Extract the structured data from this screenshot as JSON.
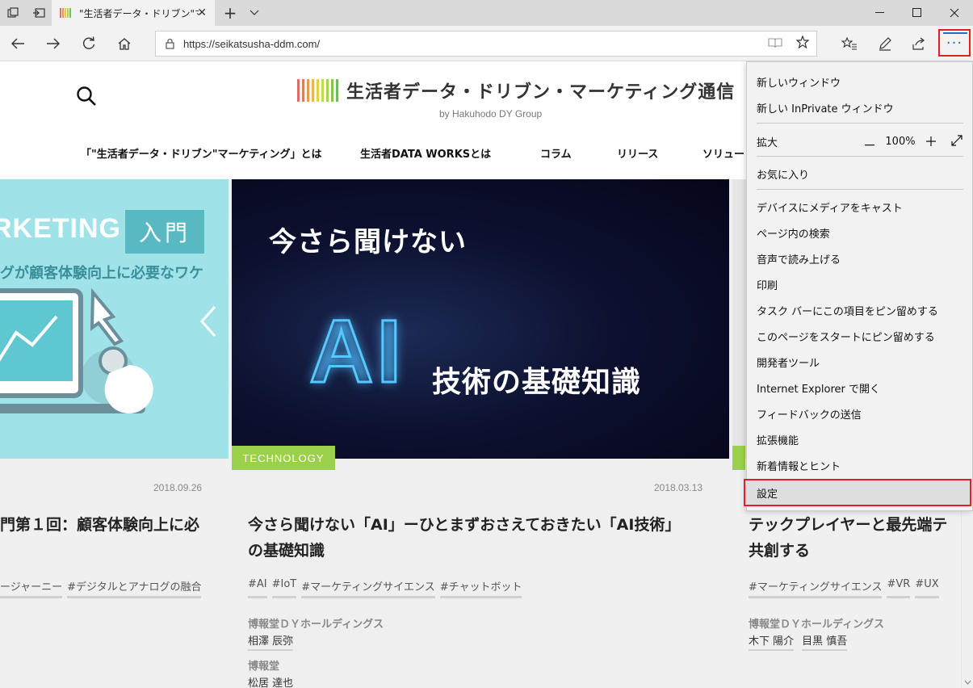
{
  "browser": {
    "tab_title": "\"生活者データ・ドリブン\"マーケ",
    "url": "https://seikatsusha-ddm.com/",
    "tab_close_glyph": "✕",
    "new_tab_glyph": "+",
    "more_glyph": "···"
  },
  "site": {
    "logo_text": "生活者データ・ドリブン・マーケティング通信",
    "logo_sub": "by Hakuhodo DY Group",
    "nav": [
      "「\"生活者データ・ドリブン\"マーケティング」とは",
      "生活者DATA WORKSとは",
      "コラム",
      "リリース",
      "ソリュー"
    ]
  },
  "cards": {
    "left": {
      "hero_word": "RKETING",
      "hero_badge": "入門",
      "hero_sub": "グが顧客体験向上に必要なワケ",
      "date": "2018.09.26",
      "title": "門第１回：顧客体験向上に必",
      "tags": [
        "ージャーニー",
        "#デジタルとアナログの融合"
      ]
    },
    "mid": {
      "hero_h1": "今さら聞けない",
      "hero_ai": "AI",
      "hero_h2": "技術の基礎知識",
      "category": "TECHNOLOGY",
      "date": "2018.03.13",
      "title_line1": "今さら聞けない「AI」ーひとまずおさえておきたい「AI技術」",
      "title_line2": "の基礎知識",
      "tags": [
        "#AI",
        "#IoT",
        "#マーケティングサイエンス",
        "#チャットボット"
      ],
      "org1": "博報堂ＤＹホールディングス",
      "person1": "相澤 辰弥",
      "org2": "博報堂",
      "person2": "松居 達也"
    },
    "right": {
      "title_line1": "テックプレイヤーと最先端テ",
      "title_line2": "共創する",
      "tags": [
        "#マーケティングサイエンス",
        "#VR",
        "#UX"
      ],
      "org1": "博報堂ＤＹホールディングス",
      "persons": [
        "木下 陽介",
        "目黒 慎吾"
      ]
    }
  },
  "menu": {
    "new_window": "新しいウィンドウ",
    "new_inprivate": "新しい InPrivate ウィンドウ",
    "zoom_label": "拡大",
    "zoom_value": "100%",
    "favorites": "お気に入り",
    "cast": "デバイスにメディアをキャスト",
    "find": "ページ内の検索",
    "read_aloud": "音声で読み上げる",
    "print": "印刷",
    "pin_taskbar": "タスク バーにこの項目をピン留めする",
    "pin_start": "このページをスタートにピン留めする",
    "devtools": "開発者ツール",
    "open_ie": "Internet Explorer で開く",
    "feedback": "フィードバックの送信",
    "extensions": "拡張機能",
    "whats_new": "新着情報とヒント",
    "settings": "設定"
  },
  "colors": {
    "accent": "#1a73c9",
    "highlight": "#e32020",
    "category_green": "#9bd14a",
    "hero_left_bg": "#9fe3e9"
  }
}
